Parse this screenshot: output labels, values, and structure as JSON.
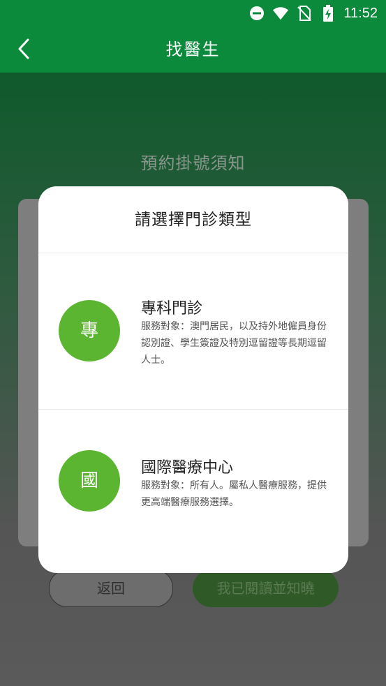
{
  "status_bar": {
    "time": "11:52",
    "icons": [
      "do-not-disturb-icon",
      "wifi-icon",
      "no-sim-icon",
      "battery-charging-icon"
    ]
  },
  "app_bar": {
    "title": "找醫生",
    "back_icon": "chevron-left-icon"
  },
  "background": {
    "notice_title": "預約掛號須知",
    "back_label": "返回",
    "confirm_label": "我已閱讀並知曉"
  },
  "modal": {
    "title": "請選擇門診類型",
    "options": [
      {
        "badge": "專",
        "title": "專科門診",
        "description": "服務對象：澳門居民，以及持外地僱員身份認別證、學生簽證及特別逗留證等長期逗留人士。"
      },
      {
        "badge": "國",
        "title": "國際醫療中心",
        "description": "服務對象：所有人。屬私人醫療服務，提供更高端醫療服務選擇。"
      }
    ]
  },
  "colors": {
    "brand_green": "#0b8a3c",
    "badge_green": "#5cb531"
  }
}
